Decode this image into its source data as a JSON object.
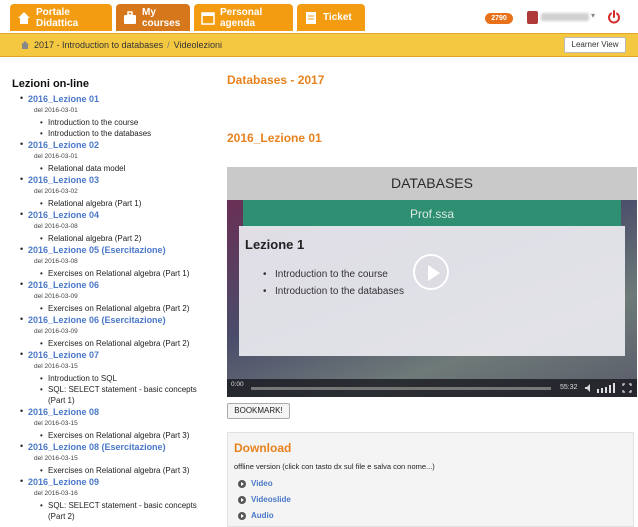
{
  "nav": {
    "tabs": [
      {
        "label": "Portale Didattica",
        "icon": "home-icon"
      },
      {
        "label": "My courses",
        "icon": "briefcase-icon"
      },
      {
        "label": "Personal agenda",
        "icon": "calendar-icon"
      },
      {
        "label": "Ticket",
        "icon": "document-icon"
      }
    ],
    "badge": "2790",
    "colors": {
      "tab": "#f39c12",
      "tab_active": "#d6771c",
      "accent": "#e8821e",
      "breadcrumb_bar": "#f5c842"
    }
  },
  "breadcrumb": {
    "items": [
      "2017 - Introduction to databases",
      "Videolezioni"
    ],
    "learner_view": "Learner View"
  },
  "sidebar": {
    "title": "Lezioni on-line",
    "lessons": [
      {
        "title": "2016_Lezione 01",
        "date": "del 2016-03-01",
        "topics": [
          "Introduction to the course",
          "Introduction to the databases"
        ]
      },
      {
        "title": "2016_Lezione 02",
        "date": "del 2016-03-01",
        "topics": [
          "Relational data model"
        ]
      },
      {
        "title": "2016_Lezione 03",
        "date": "del 2016-03-02",
        "topics": [
          "Relational algebra (Part 1)"
        ]
      },
      {
        "title": "2016_Lezione 04",
        "date": "del 2016-03-08",
        "topics": [
          "Relational algebra (Part 2)"
        ]
      },
      {
        "title": "2016_Lezione 05 (Esercitazione)",
        "date": "del 2016-03-08",
        "topics": [
          "Exercises on Relational algebra (Part 1)"
        ]
      },
      {
        "title": "2016_Lezione 06",
        "date": "del 2016-03-09",
        "topics": [
          "Exercises on Relational algebra (Part 2)"
        ]
      },
      {
        "title": "2016_Lezione 06 (Esercitazione)",
        "date": "del 2016-03-09",
        "topics": [
          "Exercises on Relational algebra (Part 2)"
        ]
      },
      {
        "title": "2016_Lezione 07",
        "date": "del 2016-03-15",
        "topics": [
          "Introduction to SQL",
          "SQL: SELECT statement - basic concepts (Part 1)"
        ]
      },
      {
        "title": "2016_Lezione 08",
        "date": "del 2016-03-15",
        "topics": [
          "Exercises on Relational algebra (Part 3)"
        ]
      },
      {
        "title": "2016_Lezione 08 (Esercitazione)",
        "date": "del 2016-03-15",
        "topics": [
          "Exercises on Relational algebra (Part 3)"
        ]
      },
      {
        "title": "2016_Lezione 09",
        "date": "del 2016-03-16",
        "topics": [
          "SQL: SELECT statement - basic concepts (Part 2)"
        ]
      }
    ]
  },
  "main": {
    "course_title": "Databases - 2017",
    "lesson_title": "2016_Lezione 01",
    "video": {
      "slide_heading": "DATABASES",
      "slide_subheading": "Prof.ssa",
      "slide_title": "Lezione 1",
      "slide_points": [
        "Introduction to the course",
        "Introduction to the databases"
      ],
      "time_elapsed": "0:00",
      "time_total": "55:32"
    },
    "bookmark_label": "BOOKMARK!",
    "download": {
      "title": "Download",
      "note": "offline version (click con tasto dx sul file e salva con nome...)",
      "links": [
        "Video",
        "Videoslide",
        "Audio"
      ]
    }
  }
}
